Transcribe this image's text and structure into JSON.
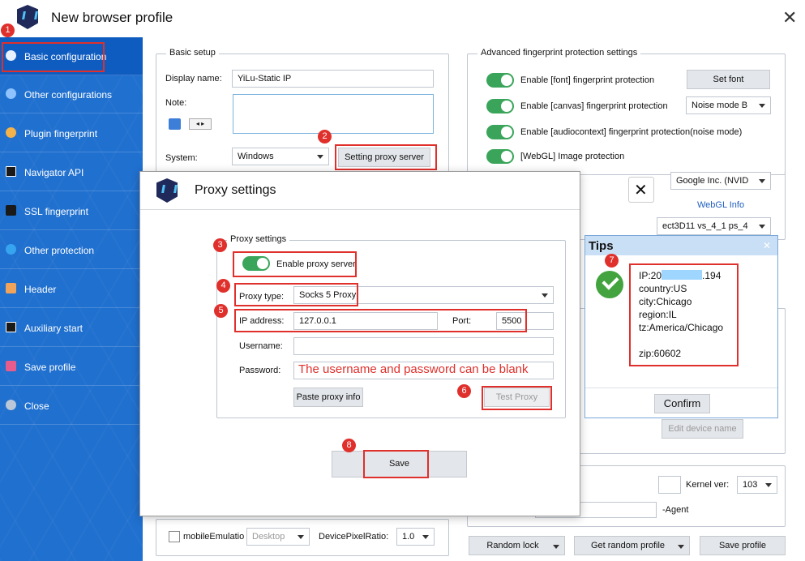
{
  "window": {
    "title": "New browser profile",
    "close_label": "✕"
  },
  "sidebar": {
    "items": [
      {
        "label": "Basic configuration",
        "icon": "compass-icon"
      },
      {
        "label": "Other configurations",
        "icon": "chrome-icon"
      },
      {
        "label": "Plugin fingerprint",
        "icon": "plugin-icon"
      },
      {
        "label": "Navigator API",
        "icon": "api-icon"
      },
      {
        "label": "SSL fingerprint",
        "icon": "lock-icon"
      },
      {
        "label": "Other protection",
        "icon": "shield-icon"
      },
      {
        "label": "Header",
        "icon": "header-icon"
      },
      {
        "label": "Auxiliary start",
        "icon": "cmd-icon"
      },
      {
        "label": "Save profile",
        "icon": "save-icon"
      },
      {
        "label": "Close",
        "icon": "close-icon"
      }
    ]
  },
  "basic_setup": {
    "title": "Basic setup",
    "display_name_label": "Display name:",
    "display_name_value": "YiLu-Static IP",
    "note_label": "Note:",
    "system_label": "System:",
    "system_value": "Windows",
    "proxy_button": "Setting proxy server"
  },
  "advanced": {
    "title": "Advanced fingerprint protection settings",
    "font": "Enable [font] fingerprint protection",
    "set_font": "Set font",
    "canvas": "Enable [canvas] fingerprint protection",
    "noise_mode": "Noise mode B",
    "audio": "Enable [audiocontext] fingerprint  protection(noise mode)",
    "webgl": "[WebGL] Image protection",
    "webgl_vendor": "Google Inc. (NVID",
    "webgl_info": "WebGL Info",
    "webgl_renderer": "ect3D11 vs_4_1 ps_4"
  },
  "bottom": {
    "mobile_emulation": "mobileEmulatio",
    "device_value": "Desktop",
    "dpr_label": "DevicePixelRatio:",
    "dpr_value": "1.0",
    "kernel_label": "Kernel ver:",
    "kernel_value": "103",
    "agent_text": "-Agent",
    "edit_device": "Edit device name",
    "random_lock": "Random lock",
    "get_random": "Get random profile",
    "save_profile": "Save profile"
  },
  "dialog": {
    "title": "Proxy settings",
    "close_label": "✕",
    "group_title": "Proxy settings",
    "enable_proxy": "Enable proxy server",
    "proxy_type_label": "Proxy type:",
    "proxy_type_value": "Socks 5 Proxy",
    "ip_label": "IP address:",
    "ip_value": "127.0.0.1",
    "port_label": "Port:",
    "port_value": "5500",
    "username_label": "Username:",
    "password_label": "Password:",
    "annotation": "The username and password can be blank",
    "paste_button": "Paste proxy info",
    "test_button": "Test Proxy",
    "save_button": "Save"
  },
  "tips": {
    "title": "Tips",
    "ip_prefix": "IP:20",
    "ip_suffix": ".194",
    "country": "country:US",
    "city": "city:Chicago",
    "region": "region:IL",
    "tz": "tz:America/Chicago",
    "zip": "zip:60602",
    "confirm": "Confirm",
    "close_label": "✕"
  },
  "badges": [
    "1",
    "2",
    "3",
    "4",
    "5",
    "6",
    "7",
    "8"
  ],
  "colors": {
    "sidebar": "#2070cf",
    "toggle_on": "#3aa55a",
    "highlight": "#e0302c",
    "annotation": "#e0302c"
  }
}
